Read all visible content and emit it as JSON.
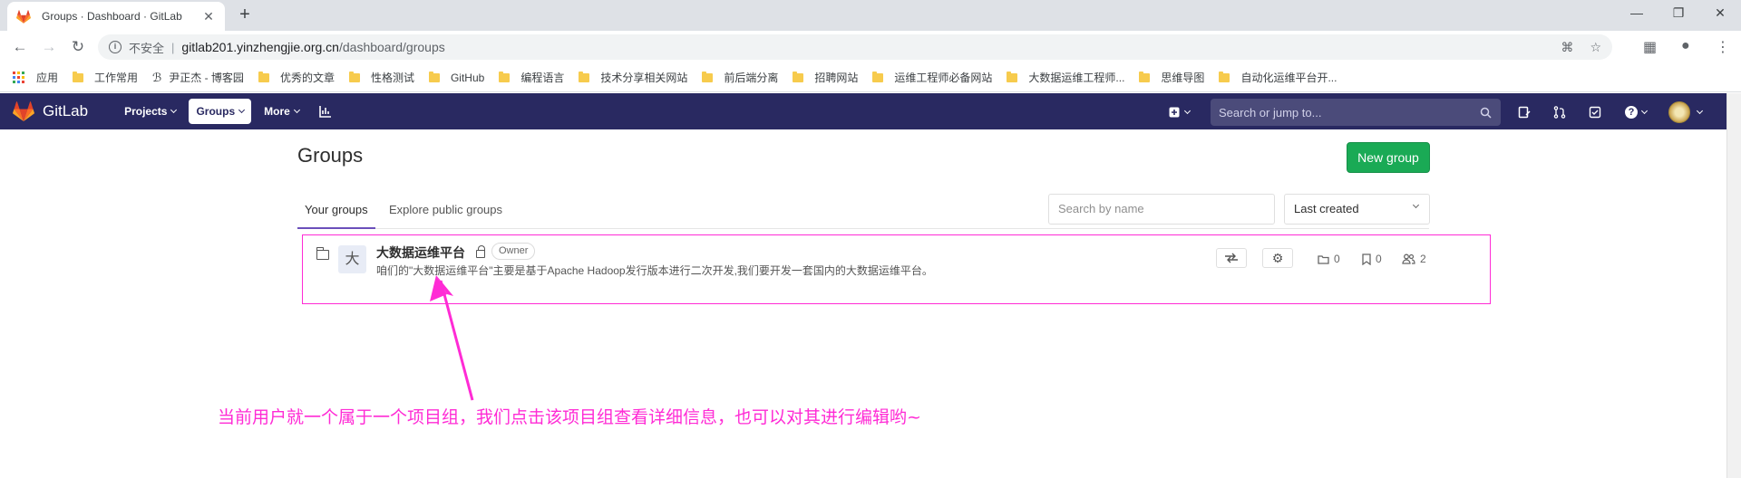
{
  "browser": {
    "tab_title": "Groups · Dashboard · GitLab",
    "insecure_label": "不安全",
    "url_host": "gitlab201.yinzhengjie.org.cn",
    "url_path": "/dashboard/groups",
    "bookmarks": [
      {
        "label": "应用",
        "type": "apps"
      },
      {
        "label": "工作常用",
        "type": "folder"
      },
      {
        "label": "尹正杰 - 博客园",
        "type": "link"
      },
      {
        "label": "优秀的文章",
        "type": "folder"
      },
      {
        "label": "性格测试",
        "type": "folder"
      },
      {
        "label": "GitHub",
        "type": "folder"
      },
      {
        "label": "编程语言",
        "type": "folder"
      },
      {
        "label": "技术分享相关网站",
        "type": "folder"
      },
      {
        "label": "前后端分离",
        "type": "folder"
      },
      {
        "label": "招聘网站",
        "type": "folder"
      },
      {
        "label": "运维工程师必备网站",
        "type": "folder"
      },
      {
        "label": "大数据运维工程师...",
        "type": "folder"
      },
      {
        "label": "思维导图",
        "type": "folder"
      },
      {
        "label": "自动化运维平台开...",
        "type": "folder"
      }
    ]
  },
  "header": {
    "brand": "GitLab",
    "nav": {
      "projects": "Projects",
      "groups": "Groups",
      "more": "More"
    },
    "search_placeholder": "Search or jump to..."
  },
  "page": {
    "title": "Groups",
    "new_group_button": "New group",
    "tabs": {
      "your_groups": "Your groups",
      "explore": "Explore public groups"
    },
    "filter_placeholder": "Search by name",
    "sort_selected": "Last created"
  },
  "group": {
    "avatar_letter": "大",
    "name": "大数据运维平台",
    "role": "Owner",
    "description": "咱们的\"大数据运维平台\"主要是基于Apache Hadoop发行版本进行二次开发,我们要开发一套国内的大数据运维平台。",
    "subgroups": "0",
    "projects": "0",
    "members": "2"
  },
  "annotation": "当前用户就一个属于一个项目组，我们点击该项目组查看详细信息，也可以对其进行编辑哟~",
  "colors": {
    "header_bg": "#292961",
    "accent_green": "#1aaa55",
    "annotation": "#ff2bd5",
    "tab_underline": "#6b4fbb"
  }
}
